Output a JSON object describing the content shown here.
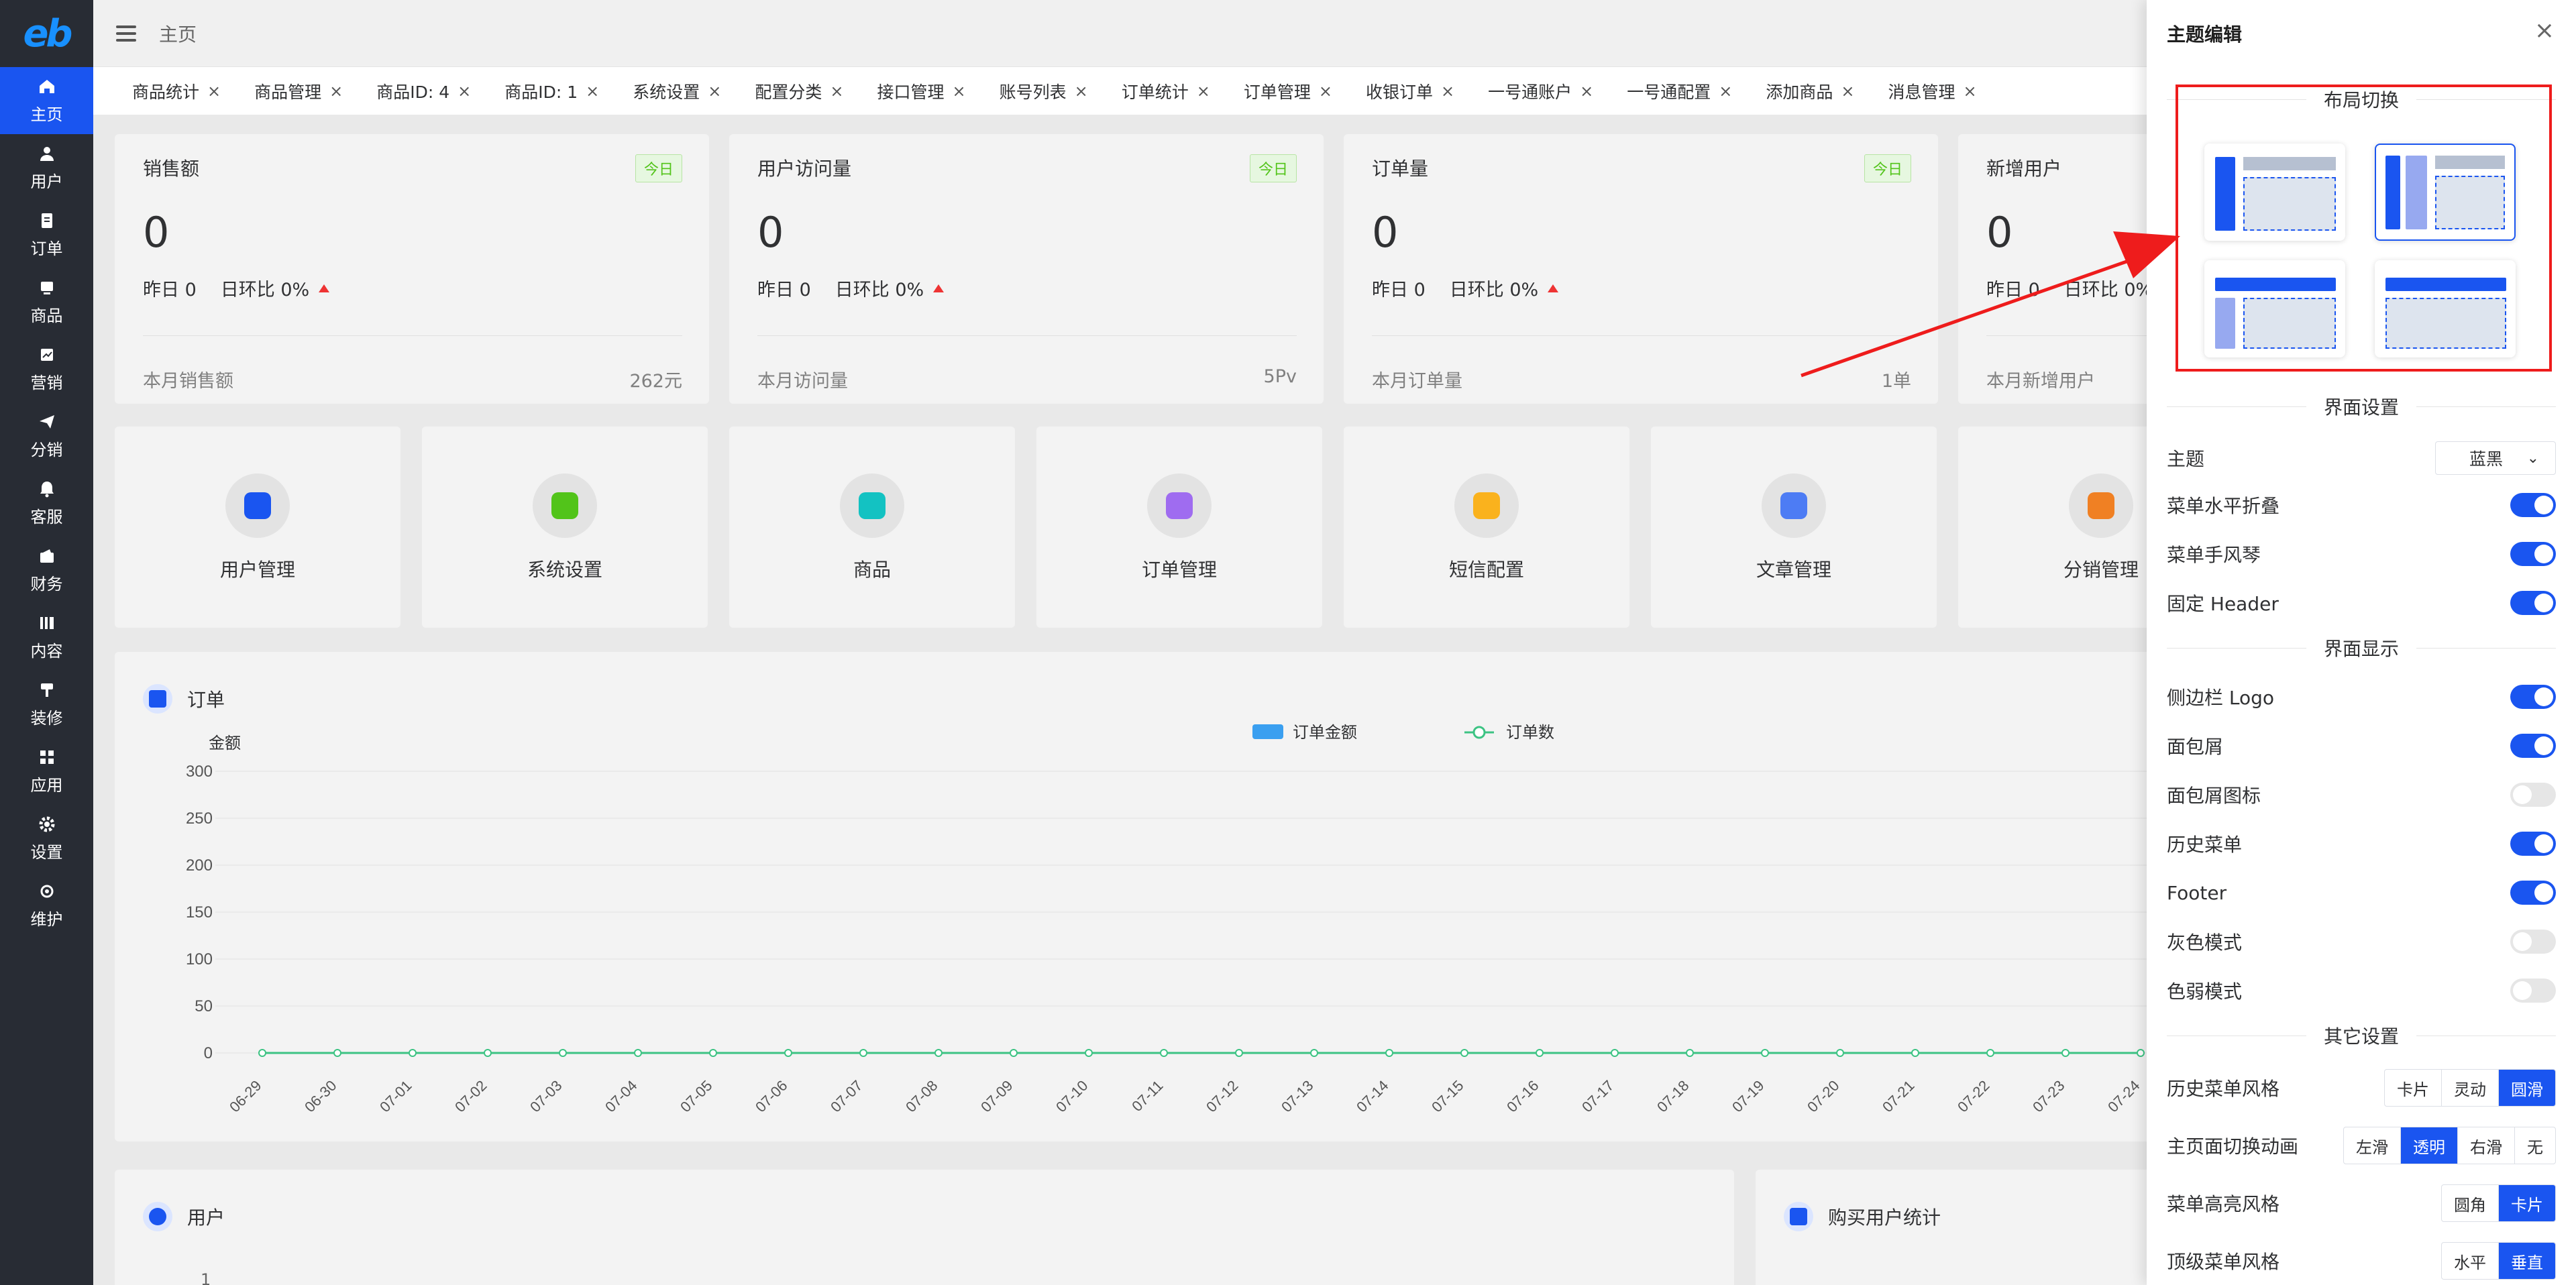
{
  "logo": "eb",
  "sidebar": {
    "items": [
      {
        "label": "主页",
        "icon": "home-icon",
        "active": true
      },
      {
        "label": "用户",
        "icon": "user-icon"
      },
      {
        "label": "订单",
        "icon": "order-icon"
      },
      {
        "label": "商品",
        "icon": "product-icon"
      },
      {
        "label": "营销",
        "icon": "marketing-icon"
      },
      {
        "label": "分销",
        "icon": "distribution-icon"
      },
      {
        "label": "客服",
        "icon": "bell-icon"
      },
      {
        "label": "财务",
        "icon": "wallet-icon"
      },
      {
        "label": "内容",
        "icon": "content-icon"
      },
      {
        "label": "装修",
        "icon": "brush-icon"
      },
      {
        "label": "应用",
        "icon": "apps-icon"
      },
      {
        "label": "设置",
        "icon": "gear-icon"
      },
      {
        "label": "维护",
        "icon": "maintenance-icon"
      }
    ]
  },
  "header": {
    "breadcrumb": "主页"
  },
  "tabs": [
    "商品统计",
    "商品管理",
    "商品ID: 4",
    "商品ID: 1",
    "系统设置",
    "配置分类",
    "接口管理",
    "账号列表",
    "订单统计",
    "订单管理",
    "收银订单",
    "一号通账户",
    "一号通配置",
    "添加商品",
    "消息管理"
  ],
  "stats": [
    {
      "title": "销售额",
      "badge": "今日",
      "value": "0",
      "yesterday": "昨日 0",
      "ratio": "日环比 0%",
      "foot_label": "本月销售额",
      "foot_value": "262元"
    },
    {
      "title": "用户访问量",
      "badge": "今日",
      "value": "0",
      "yesterday": "昨日 0",
      "ratio": "日环比 0%",
      "foot_label": "本月访问量",
      "foot_value": "5Pv"
    },
    {
      "title": "订单量",
      "badge": "今日",
      "value": "0",
      "yesterday": "昨日 0",
      "ratio": "日环比 0%",
      "foot_label": "本月订单量",
      "foot_value": "1单"
    },
    {
      "title": "新增用户",
      "badge": "",
      "value": "0",
      "yesterday": "昨日 0",
      "ratio": "日环比 0%",
      "foot_label": "本月新增用户",
      "foot_value": ""
    }
  ],
  "quick_links": [
    {
      "label": "用户管理",
      "icon": "user-manage-icon",
      "color": "#1a55f0"
    },
    {
      "label": "系统设置",
      "icon": "settings-icon",
      "color": "#52c41a"
    },
    {
      "label": "商品",
      "icon": "shop-icon",
      "color": "#13c2c2"
    },
    {
      "label": "订单管理",
      "icon": "order-doc-icon",
      "color": "#9f6cf0"
    },
    {
      "label": "短信配置",
      "icon": "sms-icon",
      "color": "#fab21d"
    },
    {
      "label": "文章管理",
      "icon": "article-icon",
      "color": "#4d7cf4"
    },
    {
      "label": "分销管理",
      "icon": "distribution-manage-icon",
      "color": "#f08023"
    }
  ],
  "order_chart": {
    "title": "订单",
    "ylabel": "金额",
    "legend_bar": "订单金额",
    "legend_line": "订单数"
  },
  "chart_data": {
    "type": "line",
    "x": [
      "06-29",
      "06-30",
      "07-01",
      "07-02",
      "07-03",
      "07-04",
      "07-05",
      "07-06",
      "07-07",
      "07-08",
      "07-09",
      "07-10",
      "07-11",
      "07-12",
      "07-13",
      "07-14",
      "07-15",
      "07-16",
      "07-17",
      "07-18",
      "07-19",
      "07-20",
      "07-21",
      "07-22",
      "07-23",
      "07-24"
    ],
    "series": [
      {
        "name": "订单金额",
        "values": [
          0,
          0,
          0,
          0,
          0,
          0,
          0,
          0,
          0,
          0,
          0,
          0,
          0,
          0,
          0,
          0,
          0,
          0,
          0,
          0,
          0,
          0,
          0,
          0,
          0,
          0
        ]
      },
      {
        "name": "订单数",
        "values": [
          0,
          0,
          0,
          0,
          0,
          0,
          0,
          0,
          0,
          0,
          0,
          0,
          0,
          0,
          0,
          0,
          0,
          0,
          0,
          0,
          0,
          0,
          0,
          0,
          0,
          0
        ]
      }
    ],
    "yticks": [
      "300",
      "250",
      "200",
      "150",
      "100",
      "50",
      "0"
    ],
    "ylim": [
      0,
      300
    ],
    "ylabel": "金额",
    "grid": true,
    "legend": "top-center"
  },
  "bottom_cards": {
    "user_title": "用户",
    "buyer_title": "购买用户统计",
    "user_tick": "1"
  },
  "panel": {
    "title": "主题编辑",
    "close": "×",
    "layout_section": "布局切换",
    "ui_section": "界面设置",
    "theme_label": "主题",
    "theme_value": "蓝黑",
    "display_section": "界面显示",
    "other_section": "其它设置",
    "settings": [
      {
        "label": "菜单水平折叠",
        "on": true
      },
      {
        "label": "菜单手风琴",
        "on": true
      },
      {
        "label": "固定 Header",
        "on": true
      }
    ],
    "display": [
      {
        "label": "侧边栏 Logo",
        "on": true
      },
      {
        "label": "面包屑",
        "on": true
      },
      {
        "label": "面包屑图标",
        "on": false
      },
      {
        "label": "历史菜单",
        "on": true
      },
      {
        "label": "Footer",
        "on": true
      },
      {
        "label": "灰色模式",
        "on": false
      },
      {
        "label": "色弱模式",
        "on": false
      }
    ],
    "other": [
      {
        "label": "历史菜单风格",
        "options": [
          "卡片",
          "灵动",
          "圆滑"
        ],
        "selected": 2
      },
      {
        "label": "主页面切换动画",
        "options": [
          "左滑",
          "透明",
          "右滑",
          "无"
        ],
        "selected": 1
      },
      {
        "label": "菜单高亮风格",
        "options": [
          "圆角",
          "卡片"
        ],
        "selected": 1
      },
      {
        "label": "顶级菜单风格",
        "options": [
          "水平",
          "垂直"
        ],
        "selected": 1
      }
    ]
  },
  "colors": {
    "accent": "#1a55f0",
    "sidebar": "#282c34",
    "annotation": "#ee1c1c",
    "line": "#3cc383"
  }
}
